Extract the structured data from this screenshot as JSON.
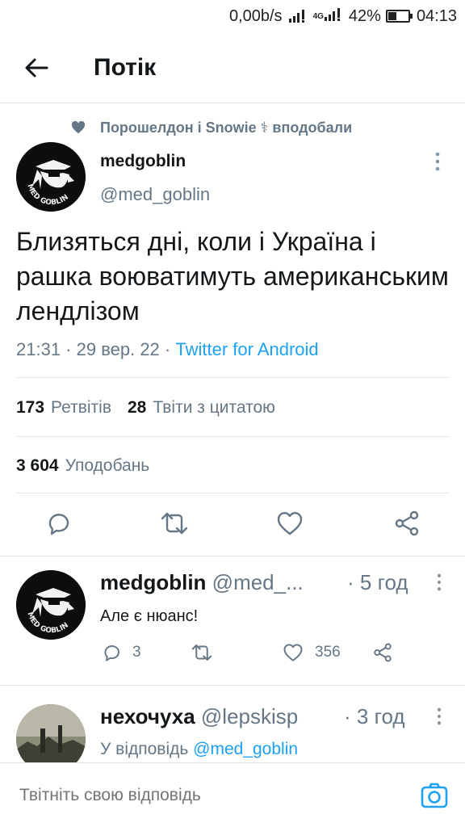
{
  "status_bar": {
    "net_speed": "0,00b/s",
    "network_type": "4G",
    "battery_percent": "42%",
    "battery_level": 0.42,
    "time": "04:13"
  },
  "app_bar": {
    "back_icon": "arrow-left-icon",
    "title": "Потік"
  },
  "main_tweet": {
    "social_context": "Порошелдон і Snowie ⚕ вподобали",
    "author_name": "medgoblin",
    "author_handle": "@med_goblin",
    "text": "Близяться дні, коли і Україна і рашка воюватимуть американським лендлізом",
    "timestamp": "21:31 · 29 вер. 22 · ",
    "client": "Twitter for Android",
    "retweets_count": "173",
    "retweets_label": "Ретвітів",
    "quotes_count": "28",
    "quotes_label": "Твіти з цитатою",
    "likes_count": "3 604",
    "likes_label": "Уподобань",
    "avatar_text": "MED GOBLIN"
  },
  "replies": [
    {
      "author_name": "medgoblin",
      "author_handle": "@med_...",
      "time": "· 5 год",
      "text": "Але є нюанс!",
      "reply_count": "3",
      "retweet_count": "",
      "like_count": "356"
    },
    {
      "author_name": "нехочуха",
      "author_handle": "@lepskisp",
      "time": "· 3 год",
      "reply_prefix": "У відповідь ",
      "reply_mention": "@med_goblin"
    }
  ],
  "composer": {
    "placeholder": "Твітніть свою відповідь",
    "camera_icon": "camera-icon"
  },
  "colors": {
    "accent": "#1da1f2",
    "secondary_text": "#657786",
    "divider": "#e1e8ed"
  }
}
